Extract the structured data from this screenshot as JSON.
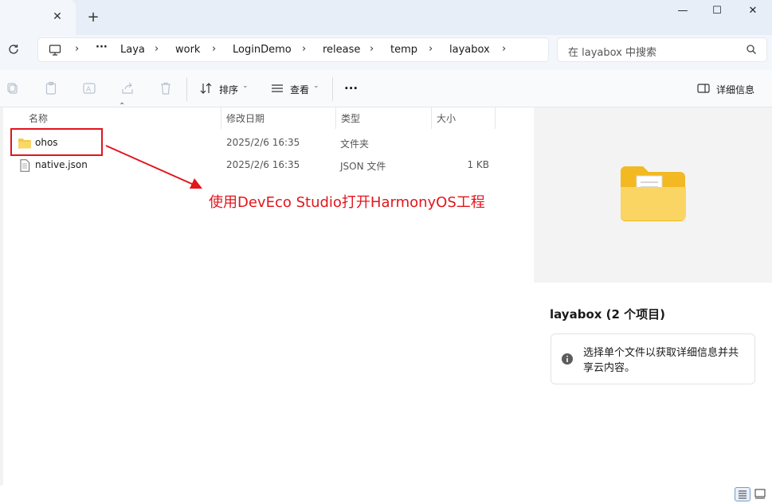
{
  "window": {
    "minimize": "—",
    "maximize": "☐",
    "close": "✕"
  },
  "tabs": {
    "close": "✕",
    "new_tab": "+"
  },
  "address": {
    "crumbs": [
      "Laya",
      "work",
      "LoginDemo",
      "release",
      "temp",
      "layabox"
    ],
    "overflow": "···",
    "search_placeholder": "在 layabox 中搜索"
  },
  "toolbar": {
    "sort_label": "排序",
    "view_label": "查看",
    "more_label": "···",
    "details_label": "详细信息"
  },
  "columns": {
    "name": "名称",
    "modified": "修改日期",
    "type": "类型",
    "size": "大小"
  },
  "files": [
    {
      "name": "ohos",
      "modified": "2025/2/6 16:35",
      "type": "文件夹",
      "size": ""
    },
    {
      "name": "native.json",
      "modified": "2025/2/6 16:35",
      "type": "JSON 文件",
      "size": "1 KB"
    }
  ],
  "annotation": {
    "text": "使用DevEco Studio打开HarmonyOS工程",
    "color": "#e2151c"
  },
  "details": {
    "title": "layabox (2 个项目)",
    "info": "选择单个文件以获取详细信息并共享云内容。"
  },
  "colors": {
    "accent": "#0067c0",
    "folder": "#f7c948",
    "annotation_red": "#e2151c"
  }
}
